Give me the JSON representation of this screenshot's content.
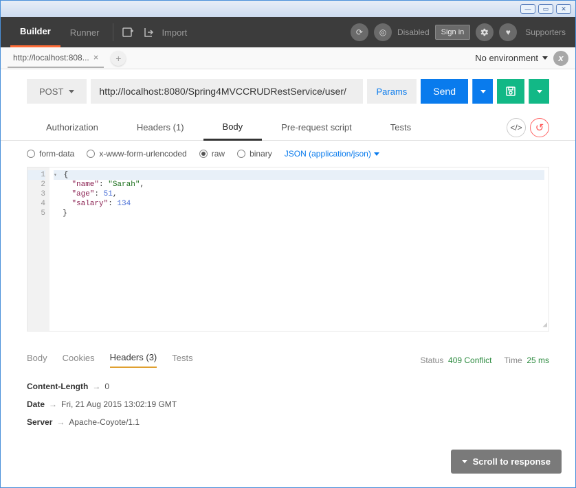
{
  "nav": {
    "builder": "Builder",
    "runner": "Runner",
    "import": "Import"
  },
  "header": {
    "disabled": "Disabled",
    "signin": "Sign in",
    "supporters": "Supporters"
  },
  "tabs": {
    "name": "http://localhost:808..."
  },
  "env": {
    "label": "No environment"
  },
  "request": {
    "method": "POST",
    "url": "http://localhost:8080/Spring4MVCCRUDRestService/user/",
    "params": "Params",
    "send": "Send"
  },
  "subtabs": {
    "auth": "Authorization",
    "headers": "Headers (1)",
    "body": "Body",
    "prereq": "Pre-request script",
    "tests": "Tests"
  },
  "bodyopts": {
    "formdata": "form-data",
    "urlenc": "x-www-form-urlencoded",
    "raw": "raw",
    "binary": "binary",
    "contenttype": "JSON (application/json)"
  },
  "editor": {
    "lines": [
      "1",
      "2",
      "3",
      "4",
      "5"
    ],
    "body": {
      "name": "Sarah",
      "age": 51,
      "salary": 134
    }
  },
  "response": {
    "tabs": {
      "body": "Body",
      "cookies": "Cookies",
      "headers": "Headers (3)",
      "tests": "Tests"
    },
    "statusLabel": "Status",
    "statusVal": "409 Conflict",
    "timeLabel": "Time",
    "timeVal": "25 ms",
    "headers": [
      {
        "k": "Content-Length",
        "v": "0"
      },
      {
        "k": "Date",
        "v": "Fri, 21 Aug 2015 13:02:19 GMT"
      },
      {
        "k": "Server",
        "v": "Apache-Coyote/1.1"
      }
    ]
  },
  "scrollBtn": "Scroll to response"
}
